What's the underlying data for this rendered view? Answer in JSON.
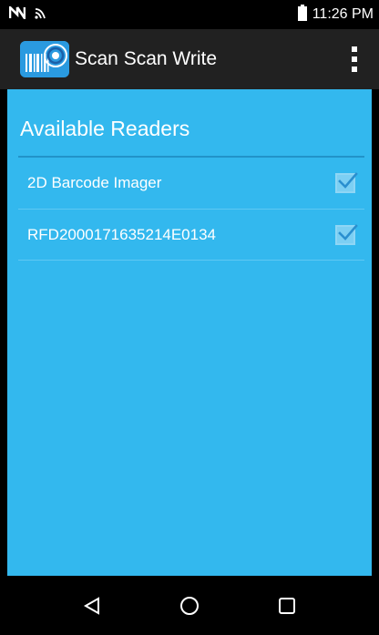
{
  "status_bar": {
    "time": "11:26 PM",
    "icons": [
      "nfc-icon",
      "wifi-icon",
      "battery-icon"
    ]
  },
  "app_bar": {
    "title": "Scan Scan Write",
    "logo_icon": "barcode-rfid-logo-icon",
    "menu_icon": "overflow-menu-icon"
  },
  "main": {
    "section_title": "Available Readers",
    "readers": [
      {
        "label": "2D Barcode Imager",
        "checked": true
      },
      {
        "label": "RFD2000171635214E0134",
        "checked": true
      }
    ]
  },
  "nav_bar": {
    "icons": [
      "back-icon",
      "home-icon",
      "recents-icon"
    ]
  },
  "colors": {
    "content_bg": "#33b8ee",
    "app_bar_bg": "#212121",
    "status_bg": "#000000",
    "divider": "#2193c9"
  }
}
